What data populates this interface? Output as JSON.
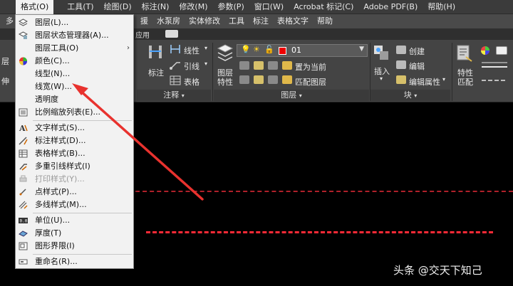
{
  "menubar": {
    "items": [
      "格式(O)",
      "工具(T)",
      "绘图(D)",
      "标注(N)",
      "修改(M)",
      "参数(P)",
      "窗口(W)",
      "Acrobat 标记(C)",
      "Adobe PDF(B)",
      "帮助(H)"
    ]
  },
  "tabs": {
    "left": "多",
    "items": [
      "援",
      "水泵房",
      "实体修改",
      "工具",
      "标注",
      "表格文字",
      "帮助"
    ],
    "sub_left": "应用"
  },
  "ribbon": {
    "linear": "线性",
    "lead": "引线",
    "table": "表格",
    "annotate": "标注",
    "annotate_panel": "注释",
    "layer_props_1": "图层",
    "layer_props_2": "特性",
    "layer_value": "01",
    "set_current": "置为当前",
    "match_layer": "匹配图层",
    "layer_panel": "图层",
    "insert": "插入",
    "create": "创建",
    "edit": "编辑",
    "edit_attr": "编辑属性",
    "block_panel": "块",
    "props_1": "特性",
    "props_2": "匹配",
    "left_label_1": "层",
    "left_label_2": "伸"
  },
  "dropdown": {
    "items": [
      {
        "label": "图层(L)...",
        "icon": "layers-icon",
        "disabled": false
      },
      {
        "label": "图层状态管理器(A)...",
        "icon": "layer-state-icon",
        "disabled": false
      },
      {
        "label": "图层工具(O)",
        "icon": "",
        "disabled": false,
        "submenu": "›"
      },
      {
        "label": "颜色(C)...",
        "icon": "color-wheel-icon",
        "disabled": false
      },
      {
        "label": "线型(N)...",
        "icon": "",
        "disabled": false
      },
      {
        "label": "线宽(W)...",
        "icon": "",
        "disabled": false
      },
      {
        "label": "透明度",
        "icon": "",
        "disabled": false
      },
      {
        "label": "比例缩放列表(E)...",
        "icon": "scale-list-icon",
        "disabled": false
      },
      {
        "label": "文字样式(S)...",
        "icon": "text-style-icon",
        "disabled": false
      },
      {
        "label": "标注样式(D)...",
        "icon": "dim-style-icon",
        "disabled": false
      },
      {
        "label": "表格样式(B)...",
        "icon": "table-style-icon",
        "disabled": false
      },
      {
        "label": "多重引线样式(I)",
        "icon": "mleader-style-icon",
        "disabled": false
      },
      {
        "label": "打印样式(Y)...",
        "icon": "plot-style-icon",
        "disabled": true
      },
      {
        "label": "点样式(P)...",
        "icon": "point-style-icon",
        "disabled": false
      },
      {
        "label": "多线样式(M)...",
        "icon": "mline-style-icon",
        "disabled": false
      },
      {
        "label": "单位(U)...",
        "icon": "units-icon",
        "disabled": false
      },
      {
        "label": "厚度(T)",
        "icon": "thickness-icon",
        "disabled": false
      },
      {
        "label": "图形界限(I)",
        "icon": "limits-icon",
        "disabled": false
      },
      {
        "label": "重命名(R)...",
        "icon": "rename-icon",
        "disabled": false
      }
    ]
  },
  "watermark": "头条 @交天下知己",
  "colors": {
    "arrow": "#e8322e",
    "menu_bg": "#f2f2f2",
    "line_red": "#ff2a36"
  }
}
